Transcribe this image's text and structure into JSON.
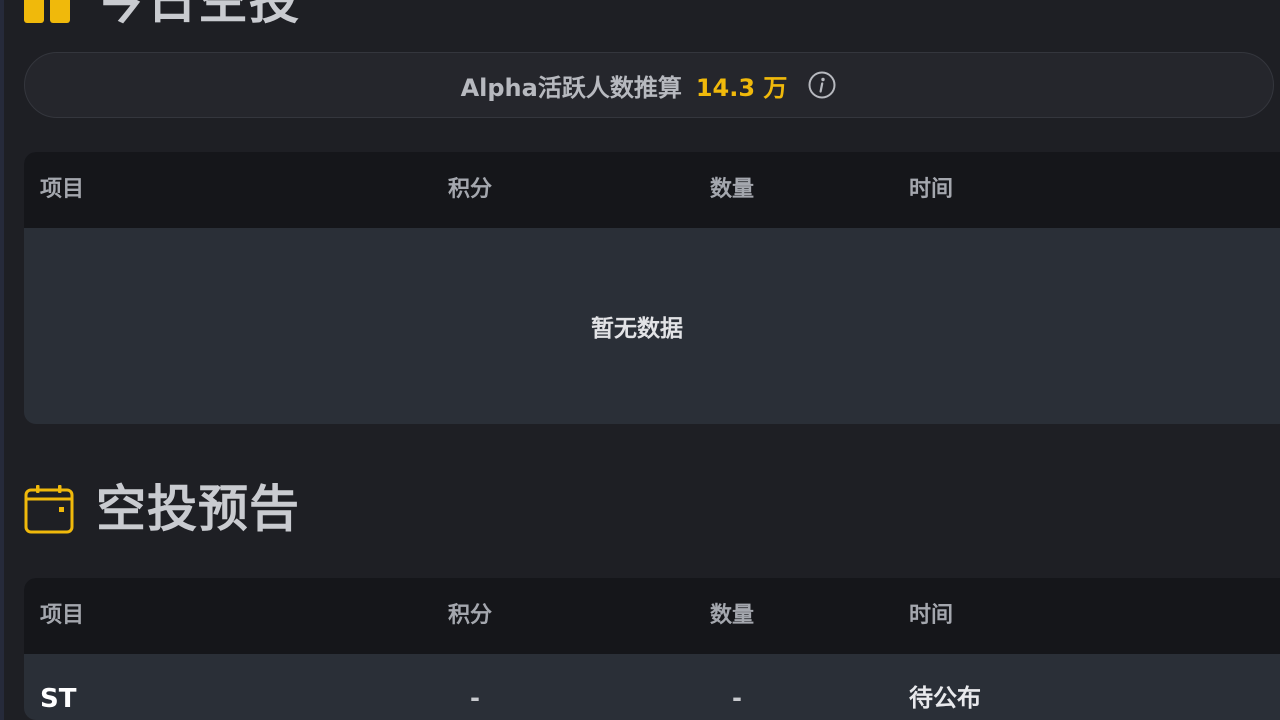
{
  "sections": {
    "today": {
      "title": "今日空投"
    },
    "preview": {
      "title": "空投预告"
    }
  },
  "stat": {
    "label": "Alpha活跃人数推算",
    "value": "14.3 万"
  },
  "tables": {
    "headers": [
      "项目",
      "积分",
      "数量",
      "时间"
    ],
    "today": {
      "empty_text": "暂无数据"
    },
    "preview": {
      "rows": [
        {
          "project": "ST",
          "points": "-",
          "quantity": "-",
          "time": "待公布"
        }
      ]
    }
  },
  "colors": {
    "accent": "#f0b90b",
    "background": "#1e1f24",
    "header_bg": "#15161a",
    "row_bg": "#2a2f37"
  },
  "icons": [
    "airdrop-icon",
    "info-icon",
    "calendar-icon"
  ]
}
